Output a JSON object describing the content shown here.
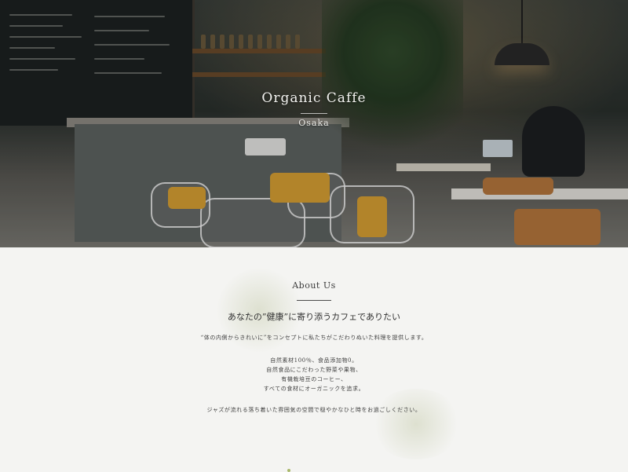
{
  "hero": {
    "title": "Organic Caffe",
    "location": "Osaka"
  },
  "about": {
    "section_label": "About Us",
    "heading": "あなたの”健康”に寄り添うカフェでありたい",
    "intro": "“体の内側からきれいに”をコンセプトに私たちがこだわりぬいた料理を提供します。",
    "features": [
      "自然素材100％、食品添加物0。",
      "自然食品にこだわった野菜や果物、",
      "有機栽培豆のコーヒー、",
      "すべての食材にオーガニックを追求。"
    ],
    "closing": "ジャズが流れる落ち着いた雰囲気の空間で穏やかなひと時をお過ごしください。"
  },
  "colors": {
    "page_background": "#f4f4f2",
    "text": "#2f2f2f",
    "accent_blur": "#cbd0b4"
  },
  "icons": {
    "hero": "cafe-photo-image"
  }
}
